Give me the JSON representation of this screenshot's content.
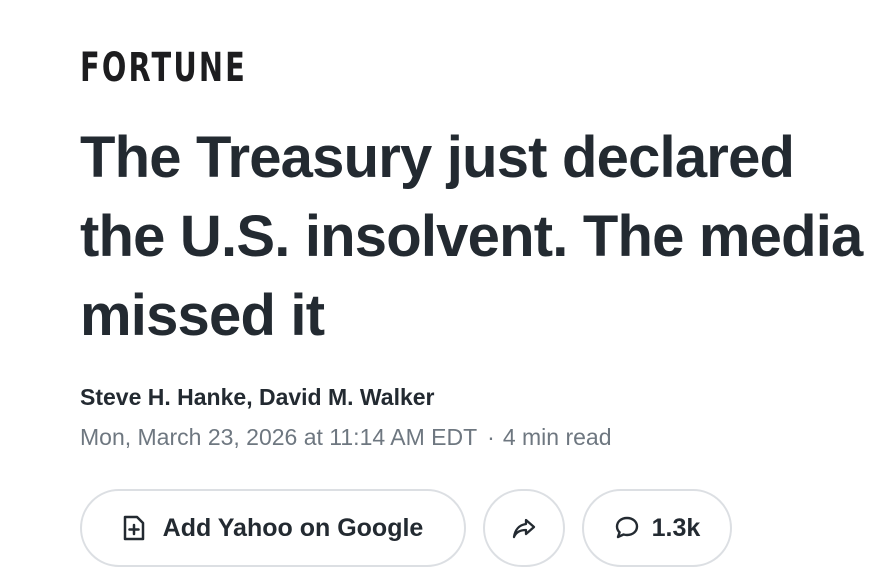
{
  "article": {
    "publisher": "FORTUNE",
    "headline": "The Treasury just declared the U.S. insolvent. The media missed it",
    "authors": "Steve H. Hanke, David M. Walker",
    "date": "Mon, March 23, 2026 at 11:14 AM EDT",
    "separator": "·",
    "read_time": "4 min read"
  },
  "actions": {
    "add_google_label": "Add Yahoo on Google",
    "add_google_icon": "add-document-icon",
    "share_icon": "share-arrow-icon",
    "comments_icon": "comment-bubble-icon",
    "comments_count": "1.3k"
  },
  "colors": {
    "text": "#232a31",
    "meta": "#6e7780",
    "border": "#dcdfe3",
    "background": "#ffffff"
  }
}
